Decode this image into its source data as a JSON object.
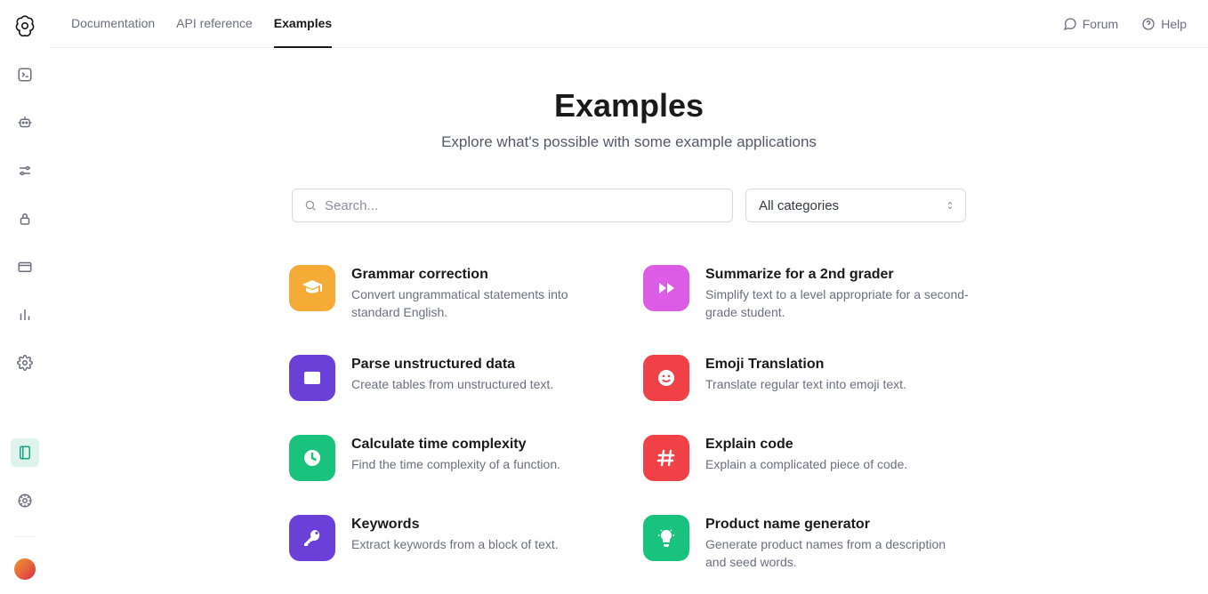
{
  "header": {
    "tabs": [
      {
        "label": "Documentation",
        "active": false
      },
      {
        "label": "API reference",
        "active": false
      },
      {
        "label": "Examples",
        "active": true
      }
    ],
    "forum": "Forum",
    "help": "Help"
  },
  "page": {
    "title": "Examples",
    "subtitle": "Explore what's possible with some example applications"
  },
  "search": {
    "placeholder": "Search..."
  },
  "filter": {
    "selected": "All categories"
  },
  "examples": [
    {
      "title": "Grammar correction",
      "desc": "Convert ungrammatical statements into standard English.",
      "color": "#f4ac36",
      "icon": "graduation"
    },
    {
      "title": "Summarize for a 2nd grader",
      "desc": "Simplify text to a level appropriate for a second-grade student.",
      "color": "#dd5ce5",
      "icon": "fast-forward"
    },
    {
      "title": "Parse unstructured data",
      "desc": "Create tables from unstructured text.",
      "color": "#6b40d8",
      "icon": "table"
    },
    {
      "title": "Emoji Translation",
      "desc": "Translate regular text into emoji text.",
      "color": "#ef4146",
      "icon": "smile"
    },
    {
      "title": "Calculate time complexity",
      "desc": "Find the time complexity of a function.",
      "color": "#19c37d",
      "icon": "clock"
    },
    {
      "title": "Explain code",
      "desc": "Explain a complicated piece of code.",
      "color": "#ef4146",
      "icon": "hash"
    },
    {
      "title": "Keywords",
      "desc": "Extract keywords from a block of text.",
      "color": "#6b40d8",
      "icon": "key"
    },
    {
      "title": "Product name generator",
      "desc": "Generate product names from a description and seed words.",
      "color": "#19c37d",
      "icon": "bulb"
    }
  ]
}
